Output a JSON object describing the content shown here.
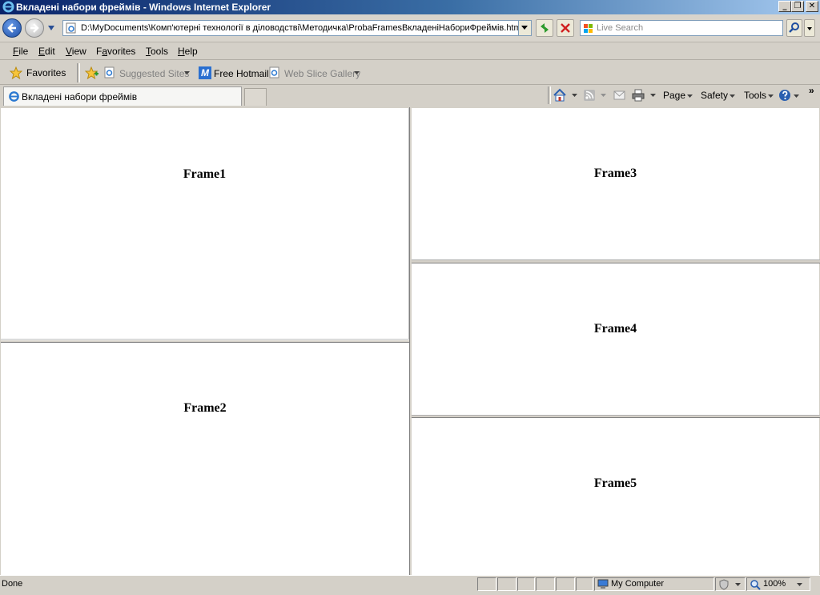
{
  "window": {
    "title": "Вкладені набори фреймів - Windows Internet Explorer"
  },
  "address": {
    "url": "D:\\MyDocuments\\Комп'ютерні технології в діловодстві\\Методичка\\ProbaFramesВкладеніНабориФреймів.htm"
  },
  "search": {
    "placeholder": "Live Search"
  },
  "menu": [
    {
      "label": "File",
      "key": "F",
      "rest": "ile"
    },
    {
      "label": "Edit",
      "key": "E",
      "rest": "dit"
    },
    {
      "label": "View",
      "key": "V",
      "rest": "iew"
    },
    {
      "label": "Favorites",
      "key": "a",
      "pre": "F",
      "rest": "vorites"
    },
    {
      "label": "Tools",
      "key": "T",
      "rest": "ools"
    },
    {
      "label": "Help",
      "key": "H",
      "rest": "elp"
    }
  ],
  "favorites_bar": {
    "favorites_label": "Favorites",
    "suggested": "Suggested Sites",
    "hotmail": "Free Hotmail",
    "slice": "Web Slice Gallery"
  },
  "tab": {
    "title": "Вкладені набори фреймів"
  },
  "command_bar": {
    "page": "Page",
    "safety": "Safety",
    "tools": "Tools"
  },
  "frames": [
    {
      "name": "Frame1"
    },
    {
      "name": "Frame2"
    },
    {
      "name": "Frame3"
    },
    {
      "name": "Frame4"
    },
    {
      "name": "Frame5"
    }
  ],
  "status": {
    "text": "Done",
    "zone": "My Computer",
    "zoom": "100%"
  }
}
